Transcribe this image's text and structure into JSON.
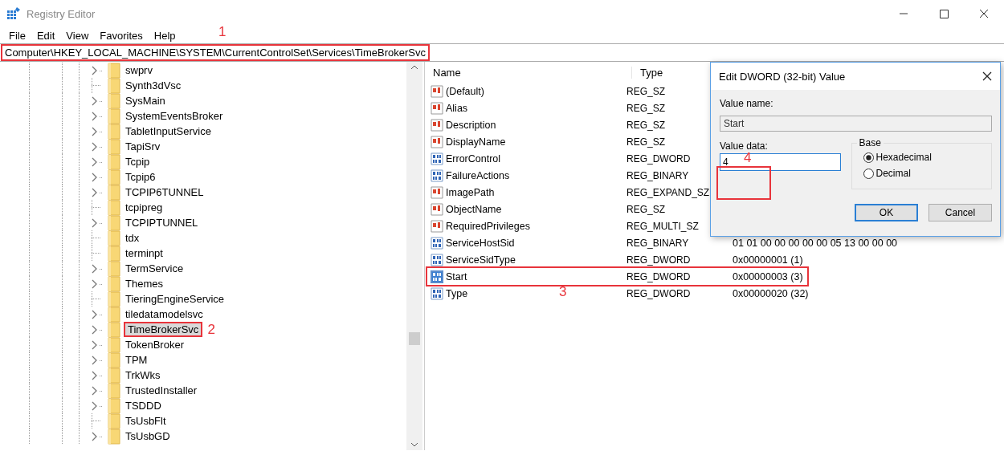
{
  "window": {
    "title": "Registry Editor"
  },
  "menu": [
    "File",
    "Edit",
    "View",
    "Favorites",
    "Help"
  ],
  "address_bar": {
    "path": "Computer\\HKEY_LOCAL_MACHINE\\SYSTEM\\CurrentControlSet\\Services\\TimeBrokerSvc",
    "callout": "1"
  },
  "tree": {
    "items": [
      {
        "label": "swprv",
        "expandable": true,
        "selected": false
      },
      {
        "label": "Synth3dVsc",
        "expandable": false,
        "selected": false
      },
      {
        "label": "SysMain",
        "expandable": true,
        "selected": false
      },
      {
        "label": "SystemEventsBroker",
        "expandable": true,
        "selected": false
      },
      {
        "label": "TabletInputService",
        "expandable": true,
        "selected": false
      },
      {
        "label": "TapiSrv",
        "expandable": true,
        "selected": false
      },
      {
        "label": "Tcpip",
        "expandable": true,
        "selected": false
      },
      {
        "label": "Tcpip6",
        "expandable": true,
        "selected": false
      },
      {
        "label": "TCPIP6TUNNEL",
        "expandable": true,
        "selected": false
      },
      {
        "label": "tcpipreg",
        "expandable": false,
        "selected": false
      },
      {
        "label": "TCPIPTUNNEL",
        "expandable": true,
        "selected": false
      },
      {
        "label": "tdx",
        "expandable": false,
        "selected": false
      },
      {
        "label": "terminpt",
        "expandable": false,
        "selected": false
      },
      {
        "label": "TermService",
        "expandable": true,
        "selected": false
      },
      {
        "label": "Themes",
        "expandable": true,
        "selected": false
      },
      {
        "label": "TieringEngineService",
        "expandable": false,
        "selected": false
      },
      {
        "label": "tiledatamodelsvc",
        "expandable": true,
        "selected": false
      },
      {
        "label": "TimeBrokerSvc",
        "expandable": true,
        "selected": true,
        "callout": "2"
      },
      {
        "label": "TokenBroker",
        "expandable": true,
        "selected": false
      },
      {
        "label": "TPM",
        "expandable": true,
        "selected": false
      },
      {
        "label": "TrkWks",
        "expandable": true,
        "selected": false
      },
      {
        "label": "TrustedInstaller",
        "expandable": true,
        "selected": false
      },
      {
        "label": "TSDDD",
        "expandable": true,
        "selected": false
      },
      {
        "label": "TsUsbFlt",
        "expandable": false,
        "selected": false
      },
      {
        "label": "TsUsbGD",
        "expandable": true,
        "selected": false
      }
    ]
  },
  "values": {
    "columns": [
      "Name",
      "Type"
    ],
    "rows": [
      {
        "name": "(Default)",
        "type": "REG_SZ",
        "kind": "string",
        "selected": false
      },
      {
        "name": "Alias",
        "type": "REG_SZ",
        "kind": "string",
        "selected": false
      },
      {
        "name": "Description",
        "type": "REG_SZ",
        "kind": "string",
        "selected": false
      },
      {
        "name": "DisplayName",
        "type": "REG_SZ",
        "kind": "string",
        "selected": false
      },
      {
        "name": "ErrorControl",
        "type": "REG_DWORD",
        "kind": "binary",
        "selected": false
      },
      {
        "name": "FailureActions",
        "type": "REG_BINARY",
        "kind": "binary",
        "selected": false
      },
      {
        "name": "ImagePath",
        "type": "REG_EXPAND_SZ",
        "kind": "string",
        "selected": false
      },
      {
        "name": "ObjectName",
        "type": "REG_SZ",
        "kind": "string",
        "selected": false
      },
      {
        "name": "RequiredPrivileges",
        "type": "REG_MULTI_SZ",
        "kind": "string",
        "selected": false
      },
      {
        "name": "ServiceHostSid",
        "type": "REG_BINARY",
        "kind": "binary",
        "selected": false,
        "data": "01 01 00 00 00 00 00 05 13 00 00 00"
      },
      {
        "name": "ServiceSidType",
        "type": "REG_DWORD",
        "kind": "binary",
        "selected": false,
        "data": "0x00000001 (1)"
      },
      {
        "name": "Start",
        "type": "REG_DWORD",
        "kind": "binary",
        "selected": true,
        "data": "0x00000003 (3)",
        "callout": "3"
      },
      {
        "name": "Type",
        "type": "REG_DWORD",
        "kind": "binary",
        "selected": false,
        "data": "0x00000020 (32)"
      }
    ]
  },
  "dialog": {
    "title": "Edit DWORD (32-bit) Value",
    "value_name_label": "Value name:",
    "value_name": "Start",
    "value_data_label": "Value data:",
    "value_data": "4",
    "value_data_callout": "4",
    "base_label": "Base",
    "bases": [
      {
        "label": "Hexadecimal",
        "selected": true
      },
      {
        "label": "Decimal",
        "selected": false
      }
    ],
    "buttons": [
      {
        "label": "OK",
        "default": true
      },
      {
        "label": "Cancel",
        "default": false
      }
    ]
  }
}
